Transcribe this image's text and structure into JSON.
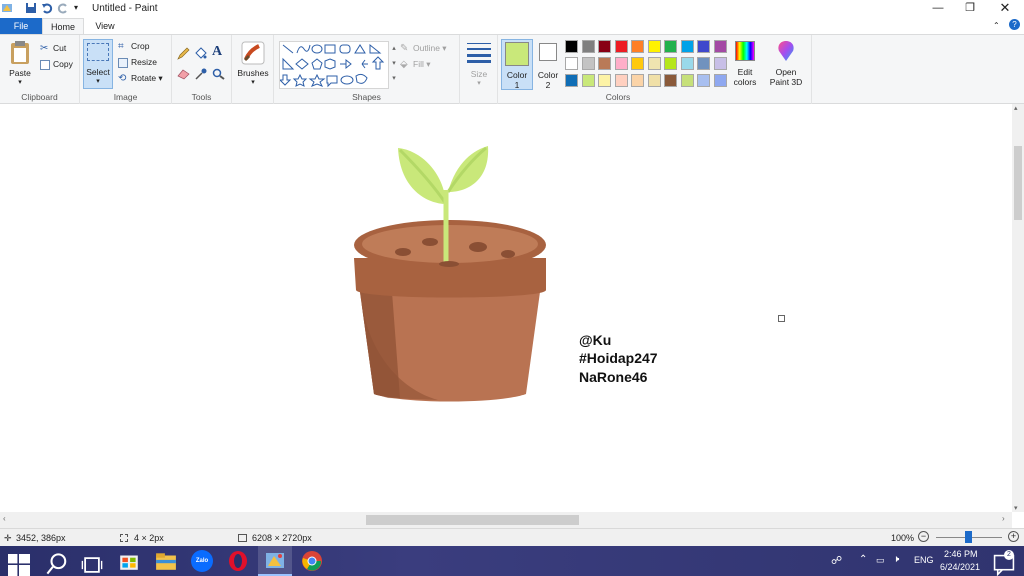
{
  "window": {
    "title": "Untitled - Paint"
  },
  "tabs": {
    "file": "File",
    "home": "Home",
    "view": "View"
  },
  "clipboard": {
    "paste": "Paste",
    "cut": "Cut",
    "copy": "Copy",
    "label": "Clipboard"
  },
  "image": {
    "select": "Select",
    "crop": "Crop",
    "resize": "Resize",
    "rotate": "Rotate",
    "label": "Image"
  },
  "tools": {
    "label": "Tools"
  },
  "brushes": {
    "label": "Brushes"
  },
  "shapes": {
    "outline": "Outline",
    "fill": "Fill",
    "label": "Shapes"
  },
  "size": {
    "label": "Size"
  },
  "colors": {
    "color1_line1": "Color",
    "color1_line2": "1",
    "color2_line1": "Color",
    "color2_line2": "2",
    "edit_line1": "Edit",
    "edit_line2": "colors",
    "paint3d_line1": "Open",
    "paint3d_line2": "Paint 3D",
    "label": "Colors",
    "color1_value": "#c9e87a",
    "color2_value": "#ffffff",
    "palette": [
      "#000000",
      "#7f7f7f",
      "#880015",
      "#ed1c24",
      "#ff7f27",
      "#fff200",
      "#22b14c",
      "#00a2e8",
      "#3f48cc",
      "#a349a4",
      "#ffffff",
      "#c3c3c3",
      "#b97a57",
      "#ffaec9",
      "#ffc90e",
      "#efe4b0",
      "#b5e61d",
      "#99d9ea",
      "#7092be",
      "#c8bfe7",
      "#0f6db5",
      "#c9e87a",
      "#fdf3a6",
      "#ffd0c0",
      "#fbd4a8",
      "#f0e0a8",
      "#8a5a3a",
      "#c6e07a",
      "#a8bff0",
      "#8fa8f0"
    ]
  },
  "canvas": {
    "sig1": "@Ku",
    "sig2": "#Hoidap247",
    "sig3": "NaRone46"
  },
  "status": {
    "cursor": "3452, 386px",
    "selection": "4 × 2px",
    "image_size": "6208 × 2720px",
    "zoom": "100%"
  },
  "taskbar": {
    "lang": "ENG",
    "time": "2:46 PM",
    "date": "6/24/2021",
    "zalo": "Zalo"
  }
}
